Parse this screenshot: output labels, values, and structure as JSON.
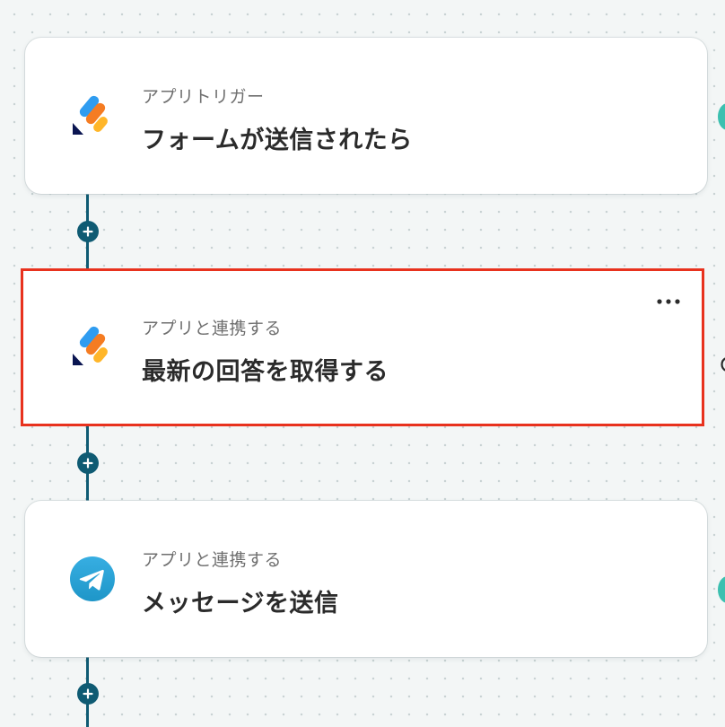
{
  "colors": {
    "connector": "#0f5b73",
    "selection_border": "#e8321e",
    "card_background": "#ffffff",
    "edge_accent": "#3cc0b0"
  },
  "steps": [
    {
      "type_label": "アプリトリガー",
      "title": "フォームが送信されたら",
      "icon": "jotform-icon",
      "selected": false
    },
    {
      "type_label": "アプリと連携する",
      "title": "最新の回答を取得する",
      "icon": "jotform-icon",
      "selected": true,
      "more_label": "•••"
    },
    {
      "type_label": "アプリと連携する",
      "title": "メッセージを送信",
      "icon": "telegram-icon",
      "selected": false
    }
  ],
  "add_buttons": [
    "plus-icon",
    "plus-icon",
    "plus-icon"
  ]
}
